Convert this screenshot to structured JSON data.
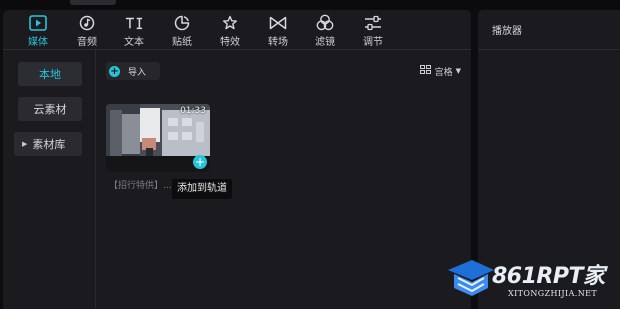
{
  "toolbar": {
    "tabs": [
      {
        "label": "媒体",
        "icon": "media-icon",
        "active": true
      },
      {
        "label": "音频",
        "icon": "audio-icon"
      },
      {
        "label": "文本",
        "icon": "text-icon"
      },
      {
        "label": "贴纸",
        "icon": "sticker-icon"
      },
      {
        "label": "特效",
        "icon": "effects-icon"
      },
      {
        "label": "转场",
        "icon": "transition-icon"
      },
      {
        "label": "滤镜",
        "icon": "filter-icon"
      },
      {
        "label": "调节",
        "icon": "adjust-icon"
      }
    ]
  },
  "sidebar": {
    "items": [
      {
        "label": "本地",
        "active": true
      },
      {
        "label": "云素材"
      },
      {
        "label": "素材库",
        "expandable": true
      }
    ]
  },
  "media": {
    "import_label": "导入",
    "view_label": "宫格",
    "clips": [
      {
        "duration": "01:33",
        "name": "【招行特供】..."
      }
    ],
    "add_tooltip": "添加到轨道"
  },
  "player": {
    "title": "播放器"
  },
  "watermark": {
    "brand": "861RPT家",
    "site": "XITONGZHIJIA.NET"
  },
  "colors": {
    "accent": "#27c4d8",
    "panel": "#1b1b1f",
    "background": "#0d0d0f"
  }
}
